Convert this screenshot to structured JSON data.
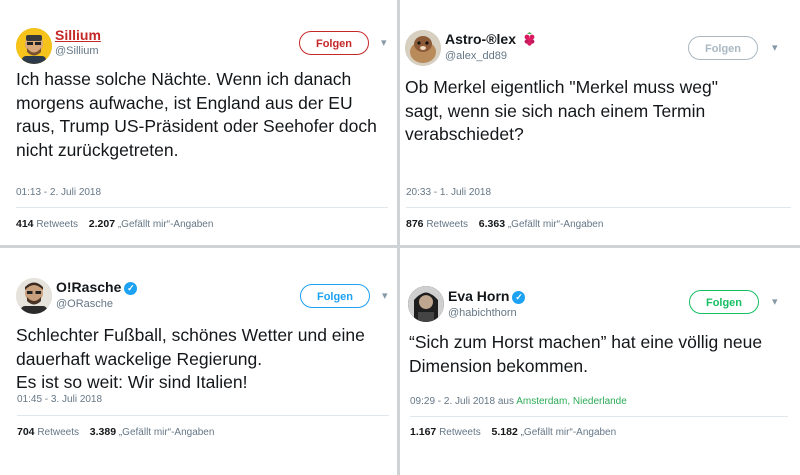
{
  "tweets": [
    {
      "name": "Sillium",
      "handle": "@Sillium",
      "follow": "Folgen",
      "text_lines": [
        "Ich hasse solche Nächte. Wenn ich danach",
        "morgens aufwache, ist England aus der EU",
        "raus, Trump US-Präsident oder Seehofer doch",
        "nicht zurückgetreten."
      ],
      "time": "01:13 - 2. Juli 2018",
      "retweets_count": "414",
      "retweets_label": "Retweets",
      "likes_count": "2.207",
      "likes_label": "„Gefällt mir“-Angaben"
    },
    {
      "name": "Astro-®lex",
      "handle": "@alex_dd89",
      "follow": "Folgen",
      "text_lines": [
        "Ob Merkel eigentlich \"Merkel muss weg\"",
        "sagt, wenn sie sich nach einem Termin",
        "verabschiedet?"
      ],
      "time": "20:33 - 1. Juli 2018",
      "retweets_count": "876",
      "retweets_label": "Retweets",
      "likes_count": "6.363",
      "likes_label": "„Gefällt mir“-Angaben"
    },
    {
      "name": "O!Rasche",
      "handle": "@ORasche",
      "follow": "Folgen",
      "text_lines": [
        "Schlechter Fußball, schönes Wetter und eine",
        "dauerhaft wackelige Regierung.",
        "Es ist so weit: Wir sind Italien!"
      ],
      "time": "01:45 - 3. Juli 2018",
      "retweets_count": "704",
      "retweets_label": "Retweets",
      "likes_count": "3.389",
      "likes_label": "„Gefällt mir“-Angaben"
    },
    {
      "name": "Eva Horn",
      "handle": "@habichthorn",
      "follow": "Folgen",
      "text_lines": [
        "“Sich zum Horst machen” hat eine völlig neue",
        "Dimension bekommen."
      ],
      "time": "09:29 - 2. Juli 2018 aus",
      "location": "Amsterdam, Niederlande",
      "retweets_count": "1.167",
      "retweets_label": "Retweets",
      "likes_count": "5.182",
      "likes_label": "„Gefällt mir“-Angaben"
    }
  ],
  "colors": {
    "background": "#cfd3d6",
    "sillium_name": "#c62828",
    "follow_red": "#c62828",
    "follow_gray": "#aab8c2",
    "follow_blue": "#1da1f2",
    "follow_green": "#17bf63",
    "verified": "#1da1f2",
    "location": "#2bab57"
  },
  "icons": {
    "chevron": "chevron-down-icon",
    "verified": "verified-badge-icon",
    "raspberry": "raspberry-emoji-icon"
  }
}
